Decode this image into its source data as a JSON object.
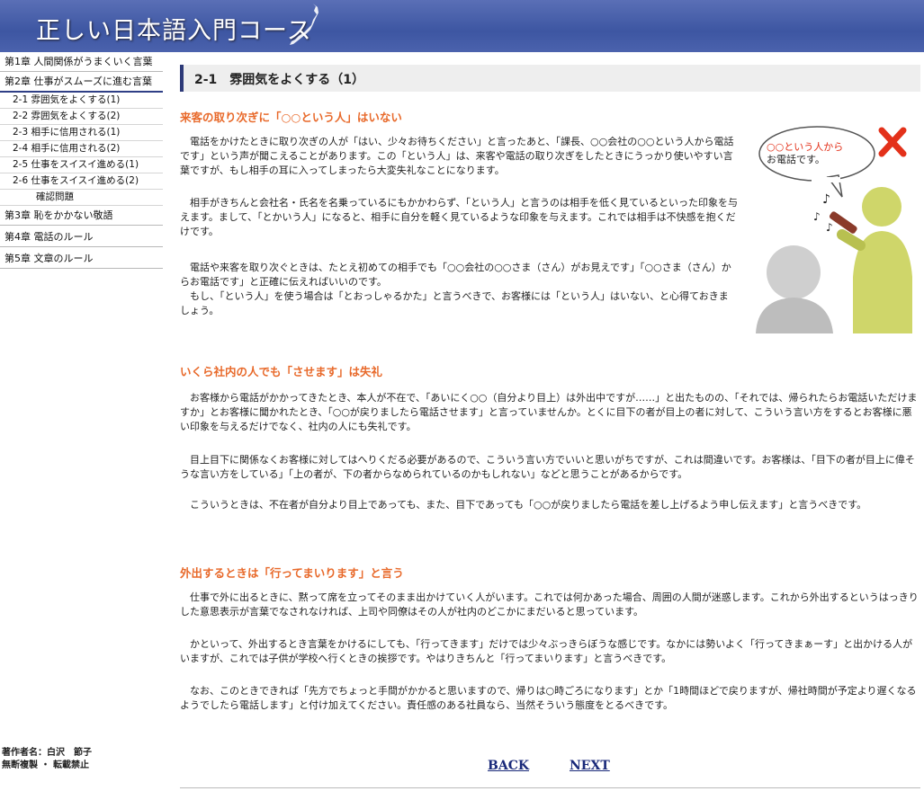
{
  "header": {
    "title": "正しい日本語入門コース"
  },
  "sidebar": {
    "chapters": [
      "第1章 人間関係がうまくいく言葉",
      "第2章 仕事がスムーズに進む言葉"
    ],
    "subitems": [
      "2-1 雰囲気をよくする(1)",
      "2-2 雰囲気をよくする(2)",
      "2-3 相手に信用される(1)",
      "2-4 相手に信用される(2)",
      "2-5 仕事をスイスイ進める(1)",
      "2-6 仕事をスイスイ進める(2)"
    ],
    "quiz": "確認問題",
    "more_chapters": [
      "第3章 恥をかかない敬語",
      "第4章 電話のルール",
      "第5章 文章のルール"
    ],
    "author_line1": "著作者名：白沢　節子",
    "author_line2": "無断複製 ・ 転載禁止"
  },
  "page": {
    "title": "2-1　雰囲気をよくする（1）",
    "bubble": "○○という人から",
    "bubble2": "お電話です。",
    "sections": [
      {
        "heading": "来客の取り次ぎに「○○という人」はいない",
        "paragraphs": [
          "　電話をかけたときに取り次ぎの人が「はい、少々お待ちください」と言ったあと、「課長、○○会社の○○という人から電話です」という声が聞こえることがあります。この「という人」は、来客や電話の取り次ぎをしたときにうっかり使いやすい言葉ですが、もし相手の耳に入ってしまったら大変失礼なことになります。",
          "　相手がきちんと会社名・氏名を名乗っているにもかかわらず、「という人」と言うのは相手を低く見ているといった印象を与えます。まして、「とかいう人」になると、相手に自分を軽く見ているような印象を与えます。これでは相手は不快感を抱くだけです。",
          "　電話や来客を取り次ぐときは、たとえ初めての相手でも「○○会社の○○さま（さん）がお見えです」「○○さま（さん）からお電話です」と正確に伝えればいいのです。\n　もし、「という人」を使う場合は「とおっしゃるかた」と言うべきで、お客様には「という人」はいない、と心得ておきましょう。"
        ]
      },
      {
        "heading": "いくら社内の人でも「させます」は失礼",
        "paragraphs": [
          "　お客様から電話がかかってきたとき、本人が不在で、「あいにく○○（自分より目上）は外出中ですが……」と出たものの、「それでは、帰られたらお電話いただけますか」とお客様に聞かれたとき、「○○が戻りましたら電話させます」と言っていませんか。とくに目下の者が目上の者に対して、こういう言い方をするとお客様に悪い印象を与えるだけでなく、社内の人にも失礼です。",
          "　目上目下に関係なくお客様に対してはへりくだる必要があるので、こういう言い方でいいと思いがちですが、これは間違いです。お客様は、「目下の者が目上に偉そうな言い方をしている」「上の者が、下の者からなめられているのかもしれない」などと思うことがあるからです。",
          "　こういうときは、不在者が自分より目上であっても、また、目下であっても「○○が戻りましたら電話を差し上げるよう申し伝えます」と言うべきです。"
        ]
      },
      {
        "heading": "外出するときは「行ってまいります」と言う",
        "paragraphs": [
          "　仕事で外に出るときに、黙って席を立ってそのまま出かけていく人がいます。これでは何かあった場合、周囲の人間が迷惑します。これから外出するというはっきりした意思表示が言葉でなされなければ、上司や同僚はその人が社内のどこかにまだいると思っています。",
          "　かといって、外出するとき言葉をかけるにしても、「行ってきます」だけでは少々ぶっきらぼうな感じです。なかには勢いよく「行ってきまぁーす」と出かける人がいますが、これでは子供が学校へ行くときの挨拶です。やはりきちんと「行ってまいります」と言うべきです。",
          "　なお、このときできれば「先方でちょっと手間がかかると思いますので、帰りは○時ごろになります」とか「1時間ほどで戻りますが、帰社時間が予定より遅くなるようでしたら電話します」と付け加えてください。責任感のある社員なら、当然そういう態度をとるべきです。"
        ]
      }
    ],
    "nav": {
      "back": "BACK",
      "next": "NEXT"
    }
  }
}
